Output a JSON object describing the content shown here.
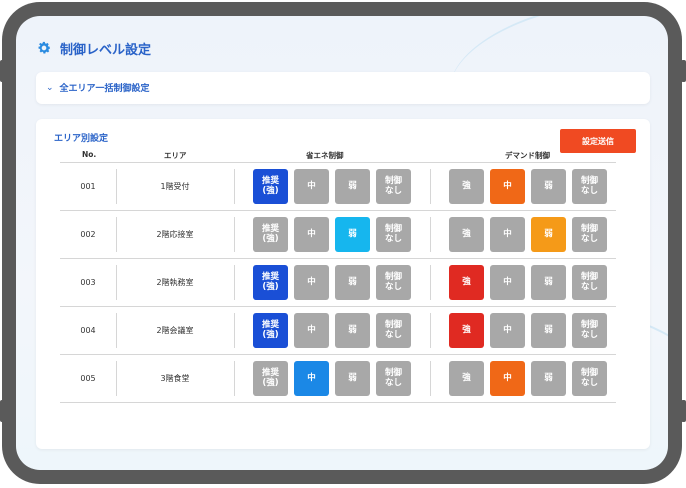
{
  "page": {
    "title": "制御レベル設定"
  },
  "bulk": {
    "label": "全エリア一括制御設定"
  },
  "area_section": {
    "title": "エリア別設定",
    "send_label": "設定送信"
  },
  "headers": {
    "no": "No.",
    "area": "エリア",
    "eco": "省エネ制御",
    "demand": "デマンド制御"
  },
  "rows": [
    {
      "no": "001",
      "area": "1階受付",
      "eco": [
        {
          "label": "推奨\n(強)",
          "color": "#1a4fd6"
        },
        {
          "label": "中",
          "color": "#a8a8a8"
        },
        {
          "label": "弱",
          "color": "#a8a8a8"
        },
        {
          "label": "制御\nなし",
          "color": "#a8a8a8"
        }
      ],
      "demand": [
        {
          "label": "強",
          "color": "#a8a8a8"
        },
        {
          "label": "中",
          "color": "#f06817"
        },
        {
          "label": "弱",
          "color": "#a8a8a8"
        },
        {
          "label": "制御\nなし",
          "color": "#a8a8a8"
        }
      ]
    },
    {
      "no": "002",
      "area": "2階応接室",
      "eco": [
        {
          "label": "推奨\n(強)",
          "color": "#a8a8a8"
        },
        {
          "label": "中",
          "color": "#a8a8a8"
        },
        {
          "label": "弱",
          "color": "#16b6ee"
        },
        {
          "label": "制御\nなし",
          "color": "#a8a8a8"
        }
      ],
      "demand": [
        {
          "label": "強",
          "color": "#a8a8a8"
        },
        {
          "label": "中",
          "color": "#a8a8a8"
        },
        {
          "label": "弱",
          "color": "#f59a18"
        },
        {
          "label": "制御\nなし",
          "color": "#a8a8a8"
        }
      ]
    },
    {
      "no": "003",
      "area": "2階執務室",
      "eco": [
        {
          "label": "推奨\n(強)",
          "color": "#1a4fd6"
        },
        {
          "label": "中",
          "color": "#a8a8a8"
        },
        {
          "label": "弱",
          "color": "#a8a8a8"
        },
        {
          "label": "制御\nなし",
          "color": "#a8a8a8"
        }
      ],
      "demand": [
        {
          "label": "強",
          "color": "#e02a22"
        },
        {
          "label": "中",
          "color": "#a8a8a8"
        },
        {
          "label": "弱",
          "color": "#a8a8a8"
        },
        {
          "label": "制御\nなし",
          "color": "#a8a8a8"
        }
      ]
    },
    {
      "no": "004",
      "area": "2階会議室",
      "eco": [
        {
          "label": "推奨\n(強)",
          "color": "#1a4fd6"
        },
        {
          "label": "中",
          "color": "#a8a8a8"
        },
        {
          "label": "弱",
          "color": "#a8a8a8"
        },
        {
          "label": "制御\nなし",
          "color": "#a8a8a8"
        }
      ],
      "demand": [
        {
          "label": "強",
          "color": "#e02a22"
        },
        {
          "label": "中",
          "color": "#a8a8a8"
        },
        {
          "label": "弱",
          "color": "#a8a8a8"
        },
        {
          "label": "制御\nなし",
          "color": "#a8a8a8"
        }
      ]
    },
    {
      "no": "005",
      "area": "3階食堂",
      "eco": [
        {
          "label": "推奨\n(強)",
          "color": "#a8a8a8"
        },
        {
          "label": "中",
          "color": "#1b88e6"
        },
        {
          "label": "弱",
          "color": "#a8a8a8"
        },
        {
          "label": "制御\nなし",
          "color": "#a8a8a8"
        }
      ],
      "demand": [
        {
          "label": "強",
          "color": "#a8a8a8"
        },
        {
          "label": "中",
          "color": "#f06817"
        },
        {
          "label": "弱",
          "color": "#a8a8a8"
        },
        {
          "label": "制御\nなし",
          "color": "#a8a8a8"
        }
      ]
    }
  ]
}
